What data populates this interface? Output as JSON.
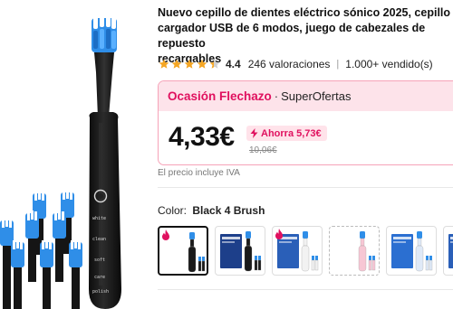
{
  "product": {
    "title": "Nuevo cepillo de dientes eléctrico sónico 2025, cepillo\ncargador USB de 6 modos, juego de cabezales de repuesto\nrecargables",
    "rating": {
      "value": "4.4",
      "stars": 4.4,
      "reviews": "246 valoraciones",
      "separator": "|",
      "sold": "1.000+ vendido(s)"
    }
  },
  "deal": {
    "name": "Ocasión Flechazo",
    "dot": "·",
    "brand": "SuperOfertas",
    "price": "4,33€",
    "savings": "Ahorra 5,73€",
    "old_price": "10,06€"
  },
  "tax_note": "El precio incluye IVA",
  "color": {
    "label": "Color:",
    "selected": "Black 4 Brush",
    "options": [
      {
        "variant": "black",
        "hot": true,
        "selected": true
      },
      {
        "variant": "black-boxed",
        "hot": false,
        "selected": false
      },
      {
        "variant": "white-box",
        "hot": true,
        "selected": false
      },
      {
        "variant": "pink-dashed",
        "hot": false,
        "selected": false
      },
      {
        "variant": "blue-box",
        "hot": false,
        "selected": false
      },
      {
        "variant": "pink-box",
        "hot": false,
        "selected": false
      },
      {
        "variant": "pink-partial",
        "hot": false,
        "selected": false
      }
    ]
  },
  "handle_labels": [
    "white",
    "clean",
    "soft",
    "care",
    "polish"
  ],
  "colors": {
    "accent": "#e0115f",
    "deal_bg": "#fde3ea",
    "deal_border": "#f6a3b8",
    "star": "#f5a623",
    "brush_blue": "#2f8ee8",
    "handle": "#1c1c1c"
  },
  "icons": {
    "star": "star-icon",
    "bolt": "bolt-icon",
    "hot": "flame-icon",
    "power": "power-button-icon"
  }
}
